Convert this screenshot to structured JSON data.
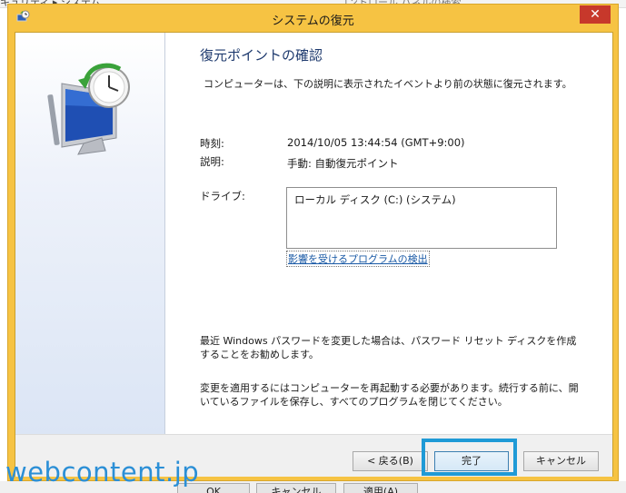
{
  "background": {
    "breadcrumb": "キュリティ ▸ システム",
    "search_placeholder": "コントロール パネルの検索",
    "buttons": [
      "OK",
      "キャンセル",
      "適用(A)"
    ]
  },
  "dialog": {
    "title": "システムの復元",
    "close_label": "✕",
    "heading": "復元ポイントの確認",
    "description": "コンピューターは、下の説明に表示されたイベントより前の状態に復元されます。",
    "time_label": "時刻:",
    "time_value": "2014/10/05 13:44:54 (GMT+9:00)",
    "desc_label": "説明:",
    "desc_value": "手動: 自動復元ポイント",
    "drive_label": "ドライブ:",
    "drive_value": "ローカル ディスク (C:) (システム)",
    "affected_programs_link": "影響を受けるプログラムの検出",
    "password_note": "最近 Windows パスワードを変更した場合は、パスワード リセット ディスクを作成することをお勧めします。",
    "restart_note": "変更を適用するにはコンピューターを再起動する必要があります。続行する前に、開いているファイルを保存し、すべてのプログラムを閉じてください。",
    "buttons": {
      "back": "< 戻る(B)",
      "finish": "完了",
      "cancel": "キャンセル"
    }
  },
  "watermark": "webcontent.jp",
  "colors": {
    "title_bar": "#f6c343",
    "close_button": "#c7382b",
    "highlight_box": "#1f9ad6",
    "heading": "#1e3a6e",
    "link": "#1a5aa6"
  }
}
